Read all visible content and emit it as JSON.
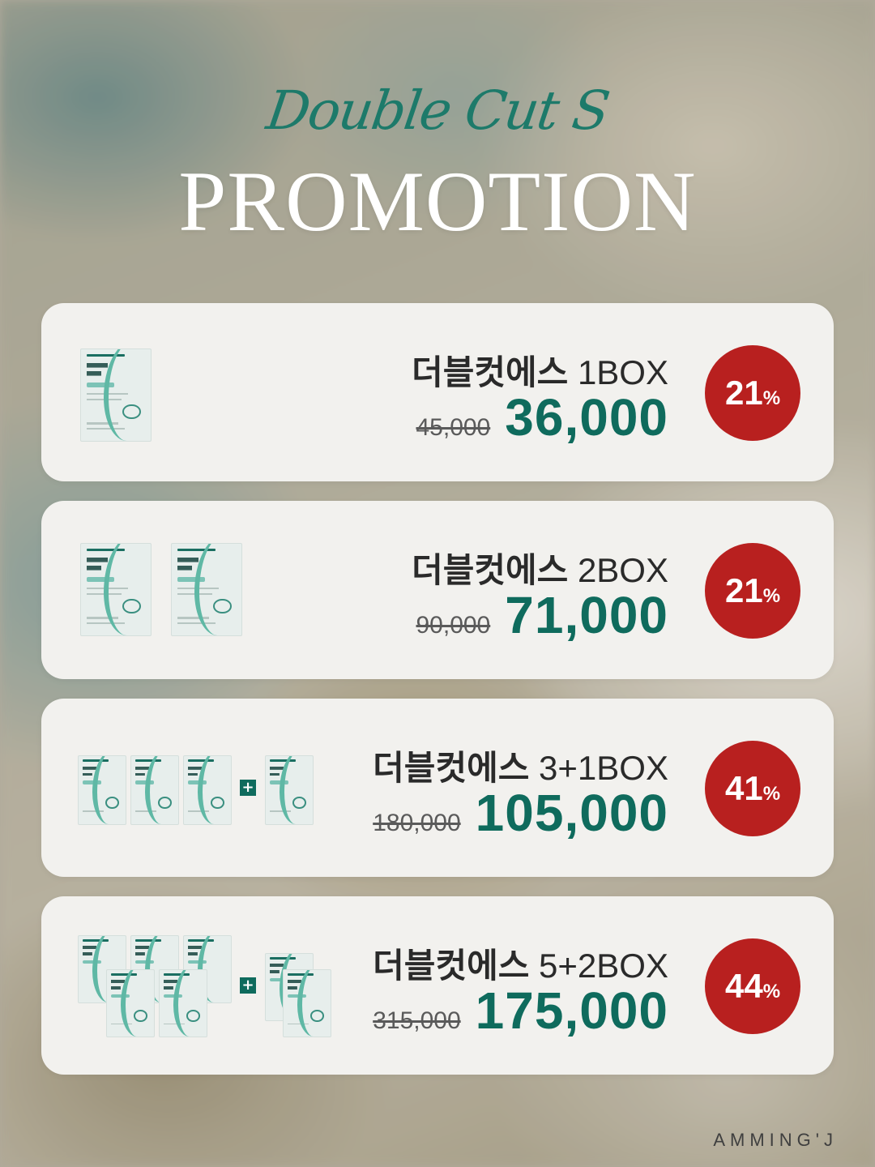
{
  "header": {
    "script_title": "Double Cut S",
    "title": "PROMOTION"
  },
  "promotions": [
    {
      "name": "더블컷에스",
      "qty": "1BOX",
      "original_price": "45,000",
      "price": "36,000",
      "discount": "21",
      "discount_unit": "%"
    },
    {
      "name": "더블컷에스",
      "qty": "2BOX",
      "original_price": "90,000",
      "price": "71,000",
      "discount": "21",
      "discount_unit": "%"
    },
    {
      "name": "더블컷에스",
      "qty": "3+1BOX",
      "original_price": "180,000",
      "price": "105,000",
      "discount": "41",
      "discount_unit": "%"
    },
    {
      "name": "더블컷에스",
      "qty": "5+2BOX",
      "original_price": "315,000",
      "price": "175,000",
      "discount": "44",
      "discount_unit": "%"
    }
  ],
  "product_box": {
    "icon": "product-box-image",
    "plus_symbol": "+"
  },
  "watermark": "AMMING'J",
  "colors": {
    "accent_green": "#0f6b5d",
    "badge_red": "#b8201f",
    "card_bg": "#f2f1ee"
  }
}
